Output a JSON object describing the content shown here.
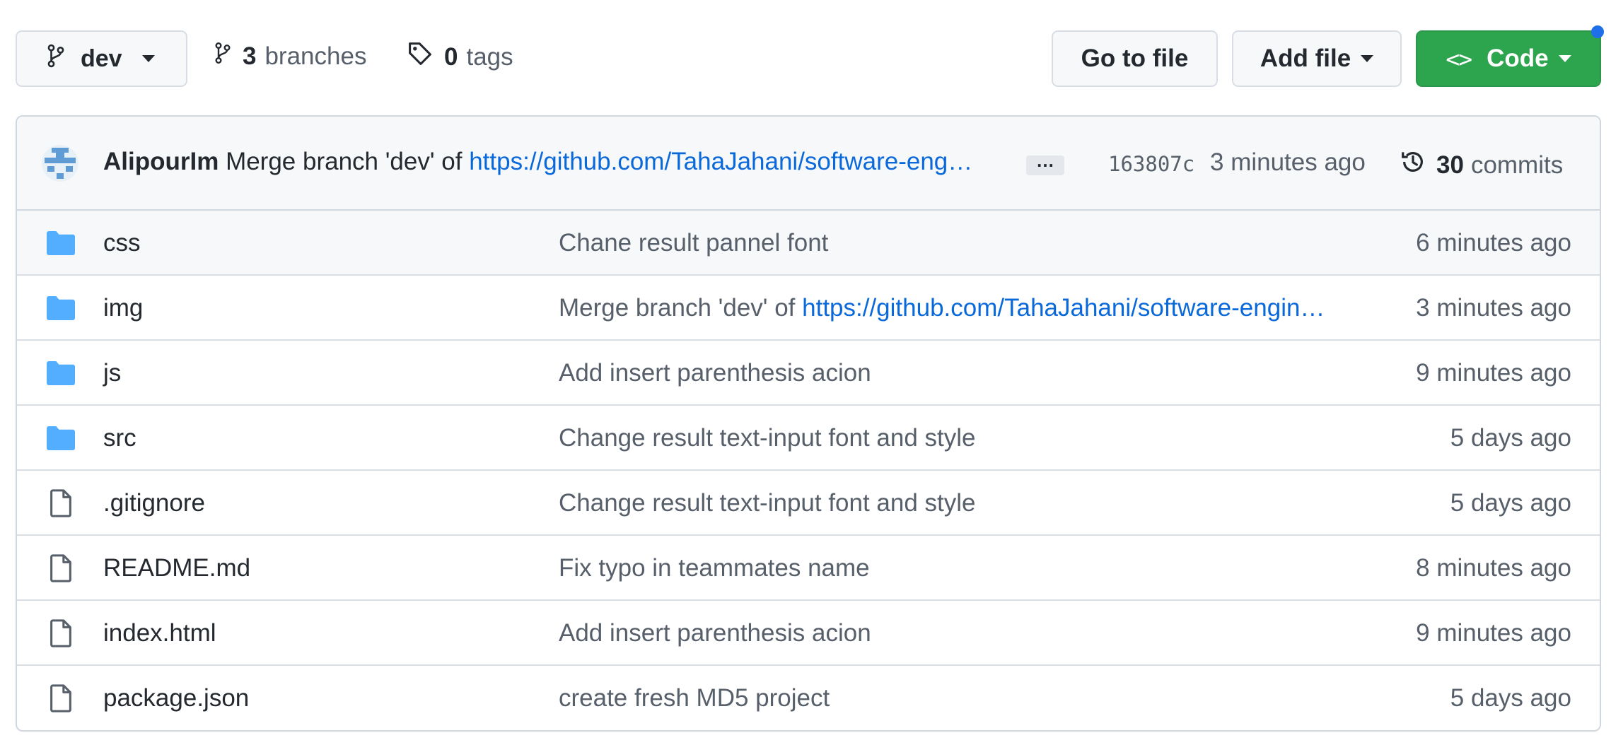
{
  "toolbar": {
    "branch_name": "dev",
    "branches_count": "3",
    "branches_label": "branches",
    "tags_count": "0",
    "tags_label": "tags",
    "goto_file_label": "Go to file",
    "add_file_label": "Add file",
    "code_label": "Code"
  },
  "latest_commit": {
    "author": "AlipourIm",
    "message_prefix": "Merge branch 'dev' of",
    "message_link": "https://github.com/TahaJahani/software-eng…",
    "ellipsis": "…",
    "sha": "163807c",
    "time": "3 minutes ago",
    "commits_count": "30",
    "commits_label": "commits"
  },
  "files": [
    {
      "type": "folder",
      "name": "css",
      "message": "Chane result pannel font",
      "link": "",
      "time": "6 minutes ago"
    },
    {
      "type": "folder",
      "name": "img",
      "message": "Merge branch 'dev' of",
      "link": "https://github.com/TahaJahani/software-engin…",
      "time": "3 minutes ago"
    },
    {
      "type": "folder",
      "name": "js",
      "message": "Add insert parenthesis acion",
      "link": "",
      "time": "9 minutes ago"
    },
    {
      "type": "folder",
      "name": "src",
      "message": "Change result text-input font and style",
      "link": "",
      "time": "5 days ago"
    },
    {
      "type": "file",
      "name": ".gitignore",
      "message": "Change result text-input font and style",
      "link": "",
      "time": "5 days ago"
    },
    {
      "type": "file",
      "name": "README.md",
      "message": "Fix typo in teammates name",
      "link": "",
      "time": "8 minutes ago"
    },
    {
      "type": "file",
      "name": "index.html",
      "message": "Add insert parenthesis acion",
      "link": "",
      "time": "9 minutes ago"
    },
    {
      "type": "file",
      "name": "package.json",
      "message": "create fresh MD5 project",
      "link": "",
      "time": "5 days ago"
    }
  ],
  "colors": {
    "accent_green": "#2da44e",
    "link_blue": "#0969da",
    "folder_blue": "#54aeff",
    "notification_dot": "#1f6feb"
  },
  "icons": {
    "branch": "git-branch-icon",
    "tag": "tag-icon",
    "code": "code-icon",
    "history": "history-icon",
    "folder": "folder-icon",
    "file": "file-icon"
  }
}
